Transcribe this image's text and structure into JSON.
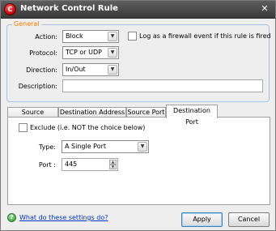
{
  "window": {
    "title": "Network Control Rule",
    "app_icon_glyph": "C",
    "close_glyph": "✕"
  },
  "general": {
    "group_title": "General",
    "action_label": "Action:",
    "action_value": "Block",
    "log_label": "Log as a firewall event if this rule is fired",
    "log_checked": false,
    "protocol_label": "Protocol:",
    "protocol_value": "TCP or UDP",
    "direction_label": "Direction:",
    "direction_value": "In/Out",
    "description_label": "Description:",
    "description_value": ""
  },
  "tabs": [
    {
      "label": "Source Address",
      "active": false
    },
    {
      "label": "Destination Address",
      "active": false
    },
    {
      "label": "Source Port",
      "active": false
    },
    {
      "label": "Destination Port",
      "active": true
    }
  ],
  "destination_port": {
    "exclude_label": "Exclude (i.e. NOT the choice below)",
    "exclude_checked": false,
    "type_label": "Type:",
    "type_value": "A Single Port",
    "port_label": "Port :",
    "port_value": "445"
  },
  "footer": {
    "help_link": "What do these settings do?",
    "help_glyph": "?",
    "apply_label": "Apply",
    "cancel_label": "Cancel"
  },
  "icons": {
    "dropdown": "▼",
    "spin_up": "▲",
    "spin_down": "▼"
  }
}
